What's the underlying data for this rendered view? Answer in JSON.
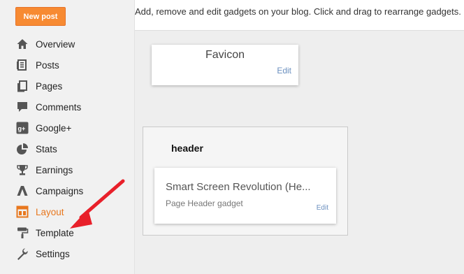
{
  "sidebar": {
    "new_post_label": "New post",
    "items": [
      {
        "label": "Overview",
        "icon": "home-icon"
      },
      {
        "label": "Posts",
        "icon": "posts-icon"
      },
      {
        "label": "Pages",
        "icon": "pages-icon"
      },
      {
        "label": "Comments",
        "icon": "comment-icon"
      },
      {
        "label": "Google+",
        "icon": "google-plus-icon"
      },
      {
        "label": "Stats",
        "icon": "stats-pie-icon"
      },
      {
        "label": "Earnings",
        "icon": "trophy-icon"
      },
      {
        "label": "Campaigns",
        "icon": "adwords-icon"
      },
      {
        "label": "Layout",
        "icon": "layout-icon",
        "active": true
      },
      {
        "label": "Template",
        "icon": "paint-roller-icon"
      },
      {
        "label": "Settings",
        "icon": "wrench-icon"
      }
    ],
    "active_color": "#e8771d"
  },
  "main": {
    "instructions": "Add, remove and edit gadgets on your blog. Click and drag to rearrange gadgets.",
    "favicon": {
      "title": "Favicon",
      "edit": "Edit"
    },
    "header_section": {
      "title": "header",
      "gadget_title": "Smart Screen Revolution (He...",
      "gadget_type": "Page Header gadget",
      "edit": "Edit"
    }
  },
  "annotation": {
    "color": "#e8202a",
    "points_to": "Template"
  }
}
